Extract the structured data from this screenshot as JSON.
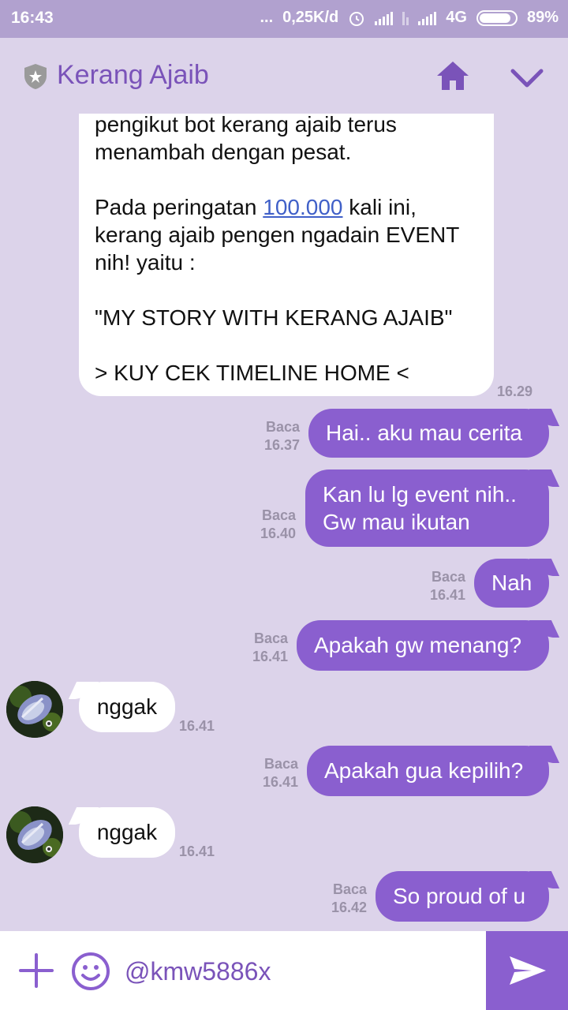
{
  "status_bar": {
    "time": "16:43",
    "dots": "...",
    "network_speed": "0,25K/d",
    "network_type": "4G",
    "battery_percent": "89%",
    "battery_level": 0.89
  },
  "header": {
    "title": "Kerang Ajaib"
  },
  "messages": {
    "m1": {
      "line1": "pengikut bot kerang ajaib terus",
      "line2": "menambah dengan pesat.",
      "line3_pre": "Pada peringatan ",
      "line3_link": "100.000",
      "line3_post": " kali ini,",
      "line4": "kerang ajaib pengen ngadain EVENT",
      "line5": "nih! yaitu :",
      "line6": "\"MY STORY WITH KERANG AJAIB\"",
      "line7": "> KUY CEK TIMELINE HOME <",
      "time": "16.29"
    },
    "m2": {
      "text": "Hai.. aku mau cerita",
      "read": "Baca",
      "time": "16.37"
    },
    "m3": {
      "line1": "Kan lu lg event nih..",
      "line2": "Gw mau ikutan",
      "read": "Baca",
      "time": "16.40"
    },
    "m4": {
      "text": "Nah",
      "read": "Baca",
      "time": "16.41"
    },
    "m5": {
      "text": "Apakah gw menang?",
      "read": "Baca",
      "time": "16.41"
    },
    "m6": {
      "text": "nggak",
      "time": "16.41"
    },
    "m7": {
      "text": "Apakah gua kepilih?",
      "read": "Baca",
      "time": "16.41"
    },
    "m8": {
      "text": "nggak",
      "time": "16.41"
    },
    "m9": {
      "text": "So proud of u",
      "read": "Baca",
      "time": "16.42"
    }
  },
  "input": {
    "value": "@kmw5886x"
  },
  "colors": {
    "accent": "#8a5fcf",
    "title": "#7a53b9",
    "background": "#dcd3ea",
    "status_bar": "#b1a1cf"
  },
  "icons": [
    "shield-star-icon",
    "home-icon",
    "chevron-down-icon",
    "plus-icon",
    "emoji-icon",
    "send-icon",
    "clock-icon",
    "signal-icon"
  ]
}
